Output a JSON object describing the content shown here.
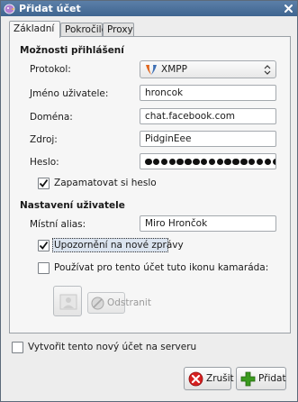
{
  "window": {
    "title": "Přidat účet"
  },
  "tabs": [
    {
      "label": "Základní",
      "active": true
    },
    {
      "label": "Pokročilé",
      "active": false
    },
    {
      "label": "Proxy",
      "active": false
    }
  ],
  "login": {
    "section_title": "Možnosti přihlášení",
    "protocol_label": "Protokol:",
    "protocol_value": "XMPP",
    "username_label": "Jméno uživatele:",
    "username_value": "hroncok",
    "domain_label": "Doména:",
    "domain_value": "chat.facebook.com",
    "resource_label": "Zdroj:",
    "resource_value": "PidginEee",
    "password_label": "Heslo:",
    "password_length": 22,
    "remember_label": "Zapamatovat si heslo",
    "remember_checked": true
  },
  "user": {
    "section_title": "Nastavení uživatele",
    "alias_label": "Místní alias:",
    "alias_value": "Miro Hrončok",
    "notify_label": "Upozornění na nové zprávy",
    "notify_checked": true,
    "buddy_icon_label": "Používat pro tento účet tuto ikonu kamaráda:",
    "buddy_icon_checked": false,
    "remove_label": "Odstranit"
  },
  "create_account": {
    "label": "Vytvořit tento nový účet na serveru",
    "checked": false
  },
  "buttons": {
    "cancel_label": "Zrušit",
    "add_label": "Přidat"
  },
  "colors": {
    "titlebar": "#4a6f9a",
    "cancel_icon": "#d62020",
    "add_icon": "#3a9a1e",
    "xmpp_icon": "#e0651c"
  }
}
